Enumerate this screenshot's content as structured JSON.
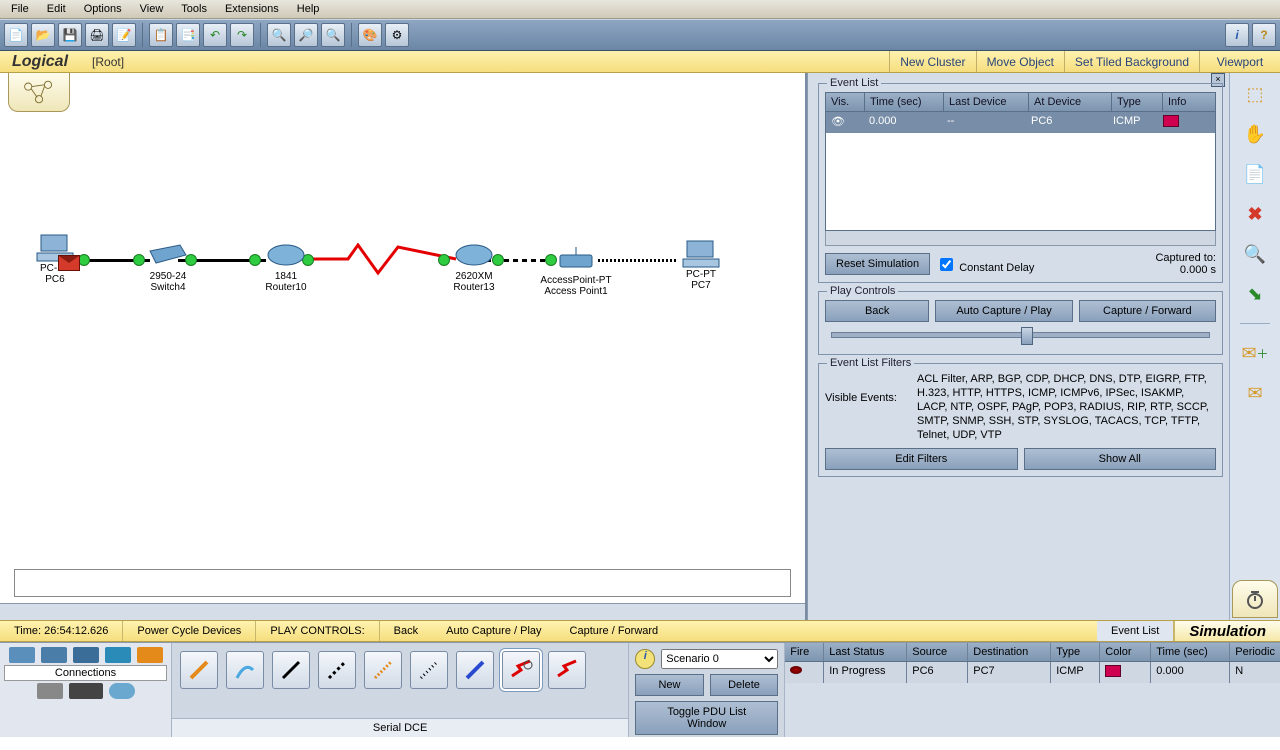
{
  "menu": {
    "file": "File",
    "edit": "Edit",
    "options": "Options",
    "view": "View",
    "tools": "Tools",
    "extensions": "Extensions",
    "help": "Help"
  },
  "ctx": {
    "logical": "Logical",
    "root": "[Root]",
    "newcluster": "New Cluster",
    "moveobj": "Move Object",
    "tiled": "Set Tiled Background",
    "viewport": "Viewport"
  },
  "topo": {
    "pc6": {
      "l1": "PC-PT",
      "l2": "PC6"
    },
    "sw": {
      "l1": "2950-24",
      "l2": "Switch4"
    },
    "r10": {
      "l1": "1841",
      "l2": "Router10"
    },
    "r13": {
      "l1": "2620XM",
      "l2": "Router13"
    },
    "ap": {
      "l1": "AccessPoint-PT",
      "l2": "Access Point1"
    },
    "pc7": {
      "l1": "PC-PT",
      "l2": "PC7"
    }
  },
  "eventlist": {
    "legend": "Event List",
    "cols": {
      "vis": "Vis.",
      "time": "Time (sec)",
      "last": "Last Device",
      "at": "At Device",
      "type": "Type",
      "info": "Info"
    },
    "row": {
      "time": "0.000",
      "last": "--",
      "at": "PC6",
      "type": "ICMP"
    },
    "reset": "Reset Simulation",
    "constant": "Constant Delay",
    "captured_l": "Captured to:",
    "captured_v": "0.000 s"
  },
  "play": {
    "legend": "Play Controls",
    "back": "Back",
    "auto": "Auto Capture / Play",
    "fwd": "Capture / Forward"
  },
  "filters": {
    "legend": "Event List Filters",
    "label": "Visible Events:",
    "list": "ACL Filter, ARP, BGP, CDP, DHCP, DNS, DTP, EIGRP, FTP, H.323, HTTP, HTTPS, ICMP, ICMPv6, IPSec, ISAKMP, LACP, NTP, OSPF, PAgP, POP3, RADIUS, RIP, RTP, SCCP, SMTP, SNMP, SSH, STP, SYSLOG, TACACS, TCP, TFTP, Telnet, UDP, VTP",
    "edit": "Edit Filters",
    "showall": "Show All"
  },
  "footer": {
    "time": "Time: 26:54:12.626",
    "power": "Power Cycle Devices",
    "plc": "PLAY CONTROLS:",
    "back": "Back",
    "auto": "Auto Capture / Play",
    "fwd": "Capture / Forward",
    "evtlist": "Event List",
    "sim": "Simulation"
  },
  "dock": {
    "connections": "Connections",
    "status": "Serial DCE",
    "scenario": "Scenario 0",
    "new": "New",
    "delete": "Delete",
    "toggle": "Toggle PDU List Window"
  },
  "pdu": {
    "cols": {
      "fire": "Fire",
      "last": "Last Status",
      "src": "Source",
      "dst": "Destination",
      "type": "Type",
      "color": "Color",
      "time": "Time (sec)",
      "periodic": "Periodic"
    },
    "row": {
      "last": "In Progress",
      "src": "PC6",
      "dst": "PC7",
      "type": "ICMP",
      "time": "0.000",
      "periodic": "N"
    }
  }
}
